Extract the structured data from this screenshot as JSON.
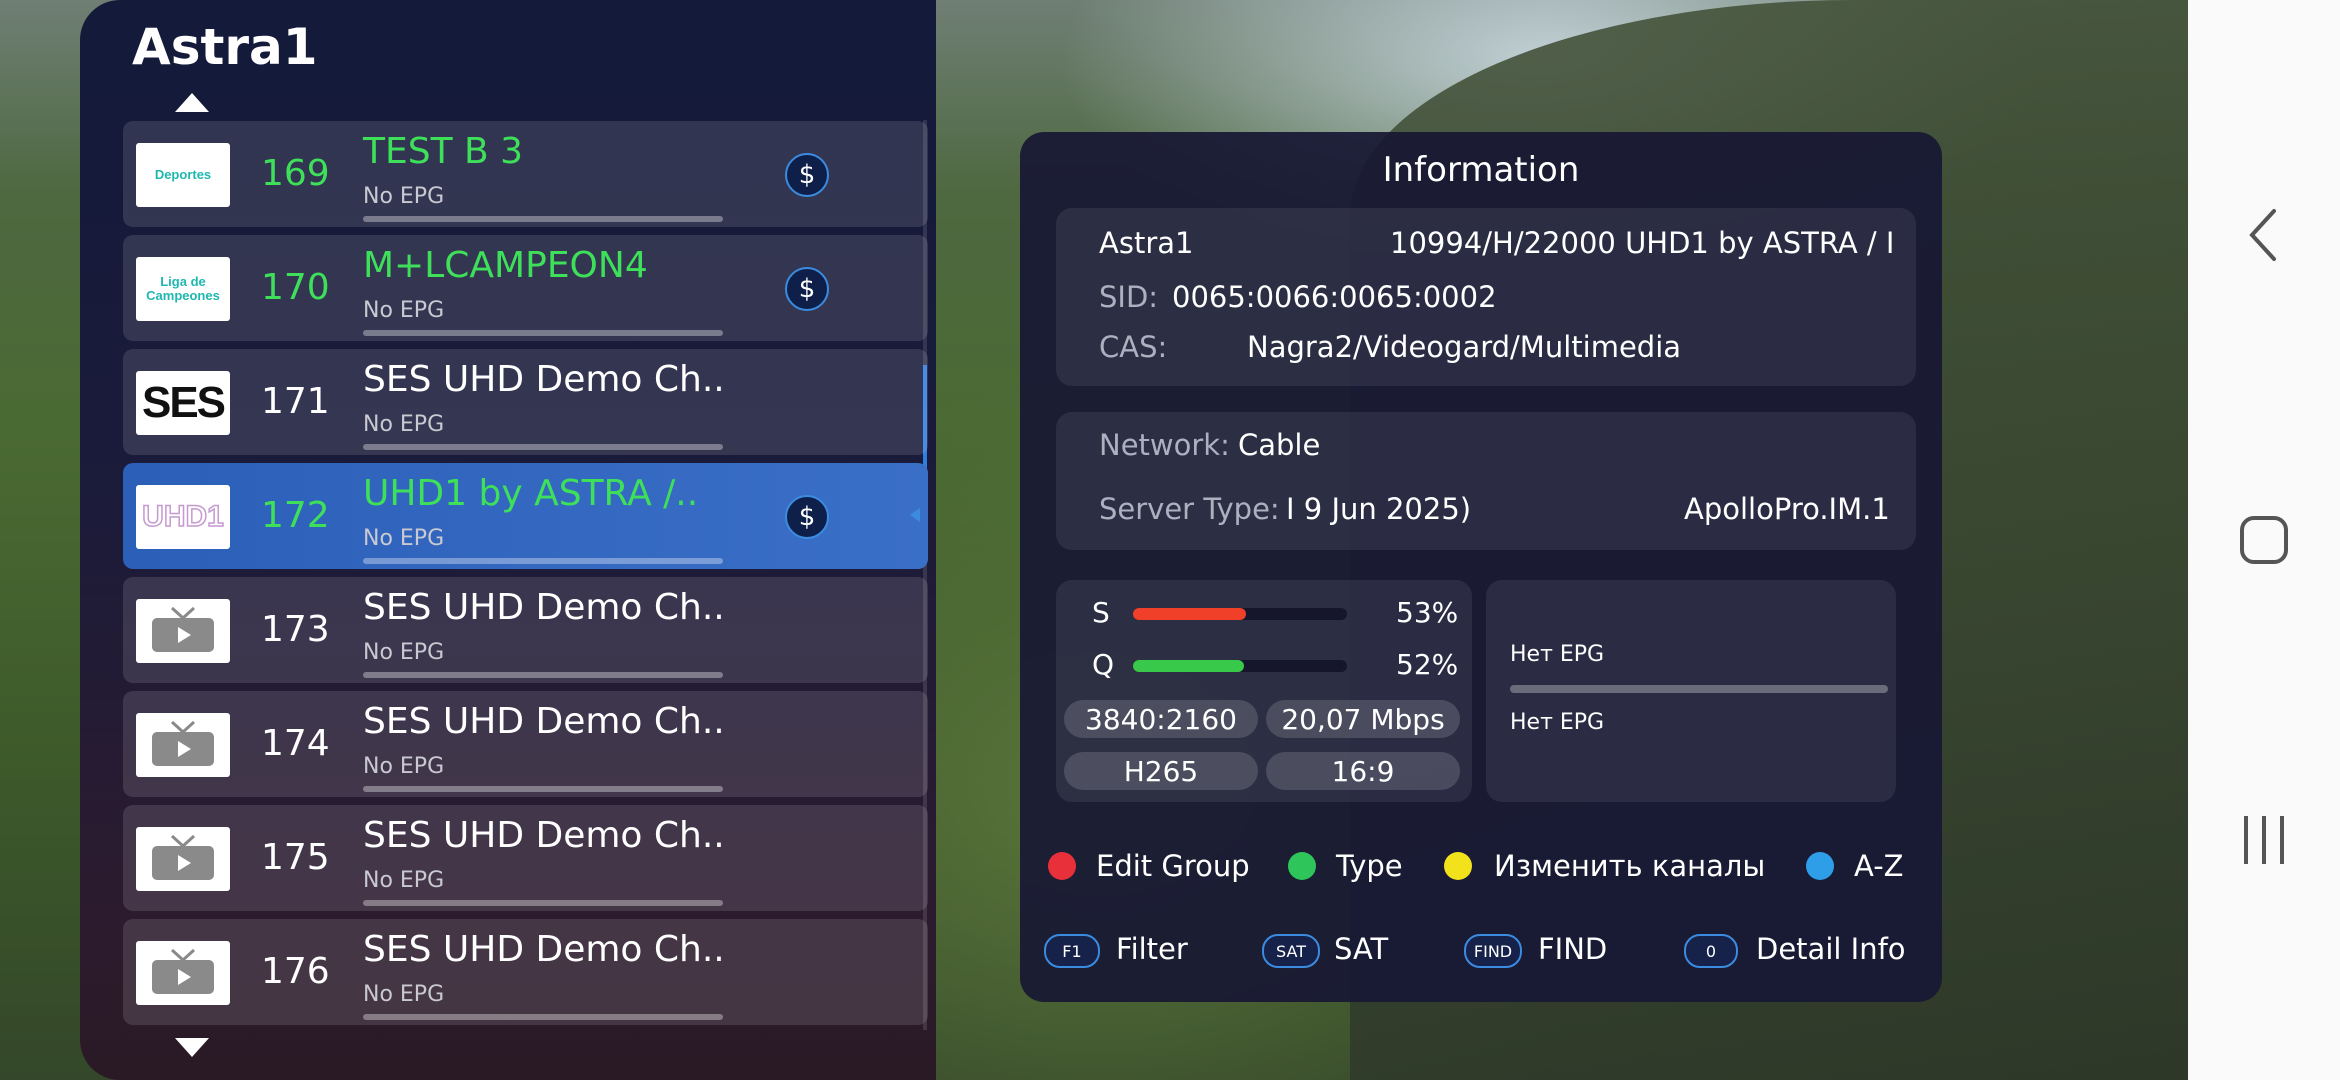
{
  "group_title": "Astra1",
  "channels": [
    {
      "number": "169",
      "name": "TEST B 3",
      "epg": "No EPG",
      "logo_text": "Deportes",
      "highlight": true,
      "paid": true
    },
    {
      "number": "170",
      "name": "M+LCAMPEON4",
      "epg": "No EPG",
      "logo_text": "Liga de Campeones",
      "highlight": true,
      "paid": true
    },
    {
      "number": "171",
      "name": "SES UHD Demo Ch..",
      "epg": "No EPG",
      "logo_text": "SES",
      "highlight": false,
      "paid": false
    },
    {
      "number": "172",
      "name": "UHD1 by ASTRA /..",
      "epg": "No EPG",
      "logo_text": "UHD1",
      "highlight": true,
      "paid": true,
      "selected": true
    },
    {
      "number": "173",
      "name": "SES UHD Demo Ch..",
      "epg": "No EPG",
      "logo_text": "",
      "highlight": false,
      "paid": false
    },
    {
      "number": "174",
      "name": "SES UHD Demo Ch..",
      "epg": "No EPG",
      "logo_text": "",
      "highlight": false,
      "paid": false
    },
    {
      "number": "175",
      "name": "SES UHD Demo Ch..",
      "epg": "No EPG",
      "logo_text": "",
      "highlight": false,
      "paid": false
    },
    {
      "number": "176",
      "name": "SES UHD Demo Ch..",
      "epg": "No EPG",
      "logo_text": "",
      "highlight": false,
      "paid": false
    }
  ],
  "paid_symbol": "$",
  "info": {
    "title": "Information",
    "satellite": "Astra1",
    "transponder": "10994/H/22000  UHD1 by ASTRA / I",
    "sid_label": "SID:",
    "sid_value": "0065:0066:0065:0002",
    "cas_label": "CAS:",
    "cas_value": "Nagra2/Videogard/Multimedia",
    "network_label": "Network:",
    "network_value": "Cable",
    "server_type_label": "Server Type:",
    "server_type_value": "I 9 Jun 2025)",
    "server_name": "ApolloPro.IM.1"
  },
  "signal": {
    "strength_label": "S",
    "strength_percent": "53%",
    "strength_value": 0.53,
    "quality_label": "Q",
    "quality_percent": "52%",
    "quality_value": 0.52,
    "resolution": "3840:2160",
    "bitrate": "20,07 Mbps",
    "codec": "H265",
    "aspect": "16:9"
  },
  "epg_panel": {
    "now": "Нет EPG",
    "next": "Нет EPG"
  },
  "legend": [
    {
      "color": "#e8303a",
      "label": "Edit Group"
    },
    {
      "color": "#2ec65a",
      "label": "Type"
    },
    {
      "color": "#f2e21c",
      "label": "Изменить каналы"
    },
    {
      "color": "#2e9ee8",
      "label": "A-Z"
    }
  ],
  "keys": [
    {
      "key": "F1",
      "label": "Filter"
    },
    {
      "key": "SAT",
      "label": "SAT"
    },
    {
      "key": "FIND",
      "label": "FIND"
    },
    {
      "key": "0",
      "label": "Detail Info"
    }
  ],
  "colors": {
    "accent": "#3b8ce0",
    "highlight_text": "#3ee05a",
    "strength_bar": "#f0402a",
    "quality_bar": "#38c94a"
  }
}
